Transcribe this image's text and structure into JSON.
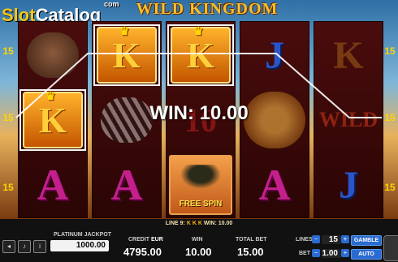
{
  "brand": {
    "logo_main": "Slot",
    "logo_accent": "Catalog",
    "logo_tld": "com"
  },
  "game": {
    "title": "WILD KINGDOM"
  },
  "paylines": {
    "left": [
      "15",
      "15",
      "15"
    ],
    "right": [
      "15",
      "15",
      "15"
    ]
  },
  "reels": [
    [
      "boar",
      "K",
      "A"
    ],
    [
      "K",
      "zebra",
      "A"
    ],
    [
      "K",
      "10",
      "FREE SPIN"
    ],
    [
      "J",
      "lion",
      "A"
    ],
    [
      "K",
      "WILD",
      "J"
    ]
  ],
  "symbol_text": {
    "K": "K",
    "A": "A",
    "J": "J",
    "10": "10",
    "wild": "WILD",
    "free_spin": "FREE SPIN"
  },
  "win_overlay": "WIN: 10.00",
  "winline_info": {
    "line": "LINE 9:",
    "symbols": "K K K",
    "win": "WIN: 10.00"
  },
  "hud": {
    "jackpot_label": "PLATINUM JACKPOT",
    "jackpot_value": "1000.00",
    "credit_label": "CREDIT",
    "currency": "EUR",
    "credit_value": "4795.00",
    "win_label": "WIN",
    "win_value": "10.00",
    "total_bet_label": "TOTAL BET",
    "total_bet_value": "15.00",
    "lines_label": "LINES",
    "lines_value": "15",
    "bet_label": "BET",
    "bet_value": "1.00",
    "gamble_label": "GAMBLE",
    "auto_label": "AUTO"
  },
  "colors": {
    "gold": "#f5c518",
    "win_frame": "#f5f5f5",
    "button_blue": "#2a6bd1"
  }
}
